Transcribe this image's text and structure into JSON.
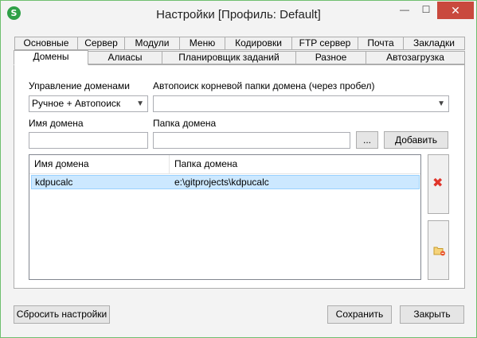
{
  "window": {
    "app_icon_letter": "S",
    "title": "Настройки [Профиль: Default]",
    "minimize_glyph": "—",
    "maximize_glyph": "☐",
    "close_glyph": "✕"
  },
  "tabs_row1": [
    "Основные",
    "Сервер",
    "Модули",
    "Меню",
    "Кодировки",
    "FTP сервер",
    "Почта",
    "Закладки"
  ],
  "tabs_row2": [
    "Домены",
    "Алиасы",
    "Планировщик заданий",
    "Разное",
    "Автозагрузка"
  ],
  "active_tab": "Домены",
  "domains": {
    "manage_label": "Управление доменами",
    "manage_value": "Ручное + Автопоиск",
    "autosearch_label": "Автопоиск корневой папки домена (через пробел)",
    "autosearch_value": "",
    "domain_name_label": "Имя домена",
    "domain_name_value": "",
    "domain_folder_label": "Папка домена",
    "domain_folder_value": "",
    "browse_label": "...",
    "add_label": "Добавить",
    "table": {
      "columns": [
        "Имя домена",
        "Папка домена"
      ],
      "rows": [
        [
          "kdpucalc",
          "e:\\gitprojects\\kdpucalc"
        ]
      ]
    },
    "delete_icon": "red-x-icon",
    "folder_icon": "folder-edit-icon",
    "delete_glyph": "✖"
  },
  "footer": {
    "reset_label": "Сбросить настройки",
    "save_label": "Сохранить",
    "close_label": "Закрыть"
  },
  "colors": {
    "close_button": "#c9493d",
    "selection": "#cce8ff",
    "app_icon": "#2fa047",
    "delete_icon": "#e0352b"
  }
}
